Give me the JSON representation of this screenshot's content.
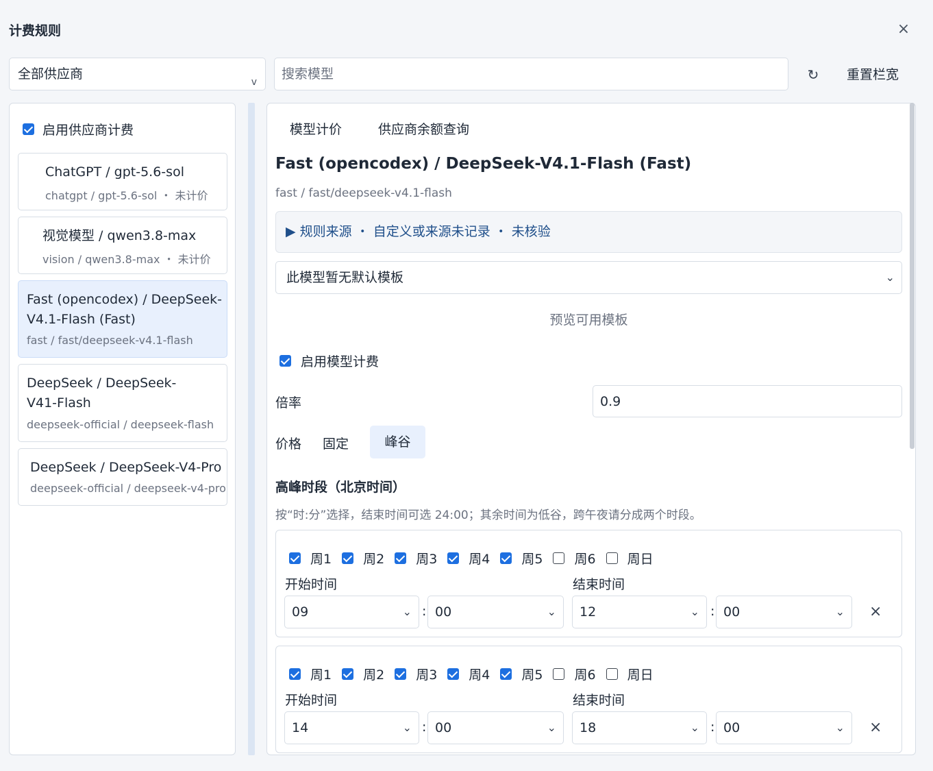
{
  "dialog": {
    "title": "计费规则",
    "close_icon": "×"
  },
  "toolbar": {
    "provider_select": "全部供应商",
    "provider_caret": "v",
    "search_placeholder": "搜索模型",
    "refresh_icon": "↻",
    "reset_label": "重置栏宽"
  },
  "sidebar": {
    "enable_label": "启用供应商计费",
    "items": [
      {
        "name": "ChatGPT / gpt-5.6-sol",
        "sub": "chatgpt / gpt-5.6-sol ・ 未计价"
      },
      {
        "name": "视觉模型 / qwen3.8-max",
        "sub": "vision / qwen3.8-max ・ 未计价"
      },
      {
        "name": "Fast (opencodex) / DeepSeek-V4.1-Flash (Fast)",
        "sub": "fast / fast/deepseek-v4.1-flash"
      },
      {
        "name": "DeepSeek / DeepSeek-V41-Flash",
        "sub": "deepseek-official / deepseek-flash"
      },
      {
        "name": "DeepSeek / DeepSeek-V4-Pro",
        "sub": "deepseek-official / deepseek-v4-pro"
      }
    ]
  },
  "detail": {
    "tabs": [
      "模型计价",
      "供应商余额查询"
    ],
    "title": "Fast (opencodex) / DeepSeek-V4.1-Flash (Fast)",
    "path": "fast / fast/deepseek-v4.1-flash",
    "source": "▶ 规则来源 ・ 自定义或来源未记录 ・ 未核验",
    "template_select": "此模型暂无默认模板",
    "preview_label": "预览可用模板",
    "enable_model_label": "启用模型计费",
    "rate_label": "倍率",
    "rate_value": "0.9",
    "price_label": "价格",
    "price_fixed": "固定",
    "price_peak": "峰谷",
    "peak_heading": "高峰时段（北京时间）",
    "peak_hint": "按“时:分”选择，结束时间可选 24:00；其余时间为低谷，跨午夜请分成两个时段。",
    "start_label": "开始时间",
    "end_label": "结束时间",
    "colon": ":",
    "delete_icon": "×",
    "chevron": "⌄",
    "periods": [
      {
        "days": [
          {
            "label": "周1",
            "checked": true
          },
          {
            "label": "周2",
            "checked": true
          },
          {
            "label": "周3",
            "checked": true
          },
          {
            "label": "周4",
            "checked": true
          },
          {
            "label": "周5",
            "checked": true
          },
          {
            "label": "周6",
            "checked": false
          },
          {
            "label": "周日",
            "checked": false
          }
        ],
        "start_hour": "09",
        "start_min": "00",
        "end_hour": "12",
        "end_min": "00"
      },
      {
        "days": [
          {
            "label": "周1",
            "checked": true
          },
          {
            "label": "周2",
            "checked": true
          },
          {
            "label": "周3",
            "checked": true
          },
          {
            "label": "周4",
            "checked": true
          },
          {
            "label": "周5",
            "checked": true
          },
          {
            "label": "周6",
            "checked": false
          },
          {
            "label": "周日",
            "checked": false
          }
        ],
        "start_hour": "14",
        "start_min": "00",
        "end_hour": "18",
        "end_min": "00"
      }
    ]
  },
  "colors": {
    "accent": "#1d6fe0",
    "active_bg": "#e8f0fd",
    "source_text": "#1f4f8a"
  }
}
